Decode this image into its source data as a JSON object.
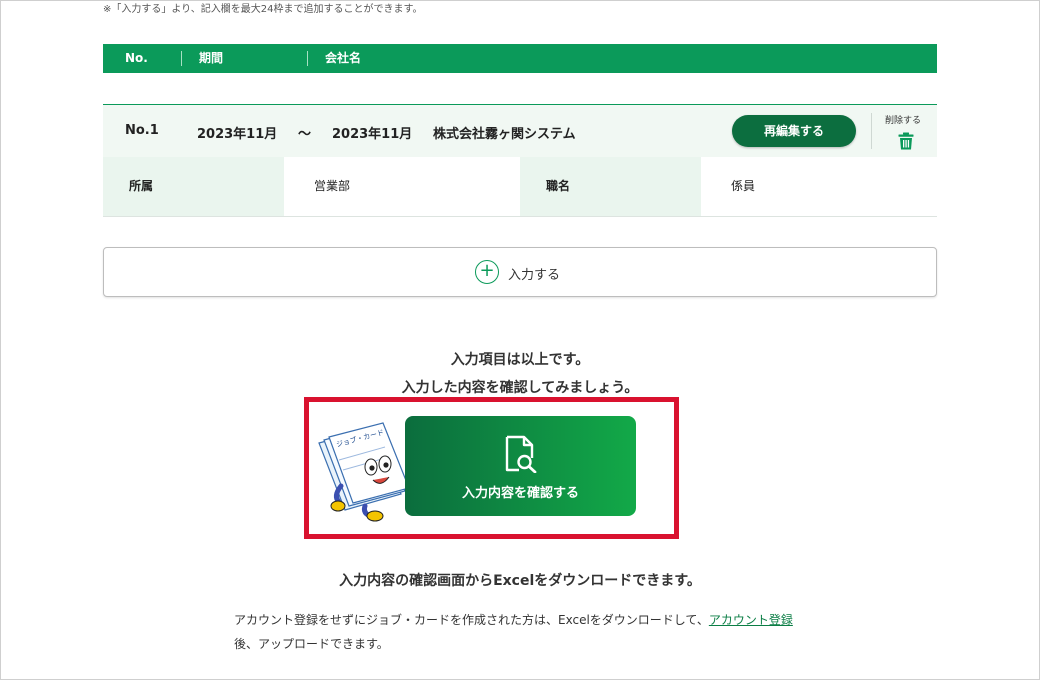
{
  "note": "※「入力する」より、記入欄を最大24枠まで追加することができます。",
  "table_header": {
    "no": "No.",
    "period": "期間",
    "company": "会社名"
  },
  "entry": {
    "no": "No.1",
    "start": "2023年11月",
    "tilde": "〜",
    "end": "2023年11月",
    "company": "株式会社霧ヶ関システム",
    "edit_label": "再編集する",
    "delete_label": "削除する",
    "dept_label": "所属",
    "dept_value": "営業部",
    "title_label": "職名",
    "title_value": "係員"
  },
  "add_label": "入力する",
  "finish_line1": "入力項目は以上です。",
  "finish_line2": "入力した内容を確認してみましょう。",
  "mascot_text": "ジョブ・カード",
  "confirm_label": "入力内容を確認する",
  "excel_heading": "入力内容の確認画面からExcelをダウンロードできます。",
  "body_part1": "アカウント登録をせずにジョブ・カードを作成された方は、Excelをダウンロードして、",
  "body_link": "アカウント登録",
  "body_part2": "後、アップロードできます。",
  "colors": {
    "primary": "#0b9a5a",
    "dark_green": "#0c6e3f",
    "highlight": "#d9122f"
  }
}
